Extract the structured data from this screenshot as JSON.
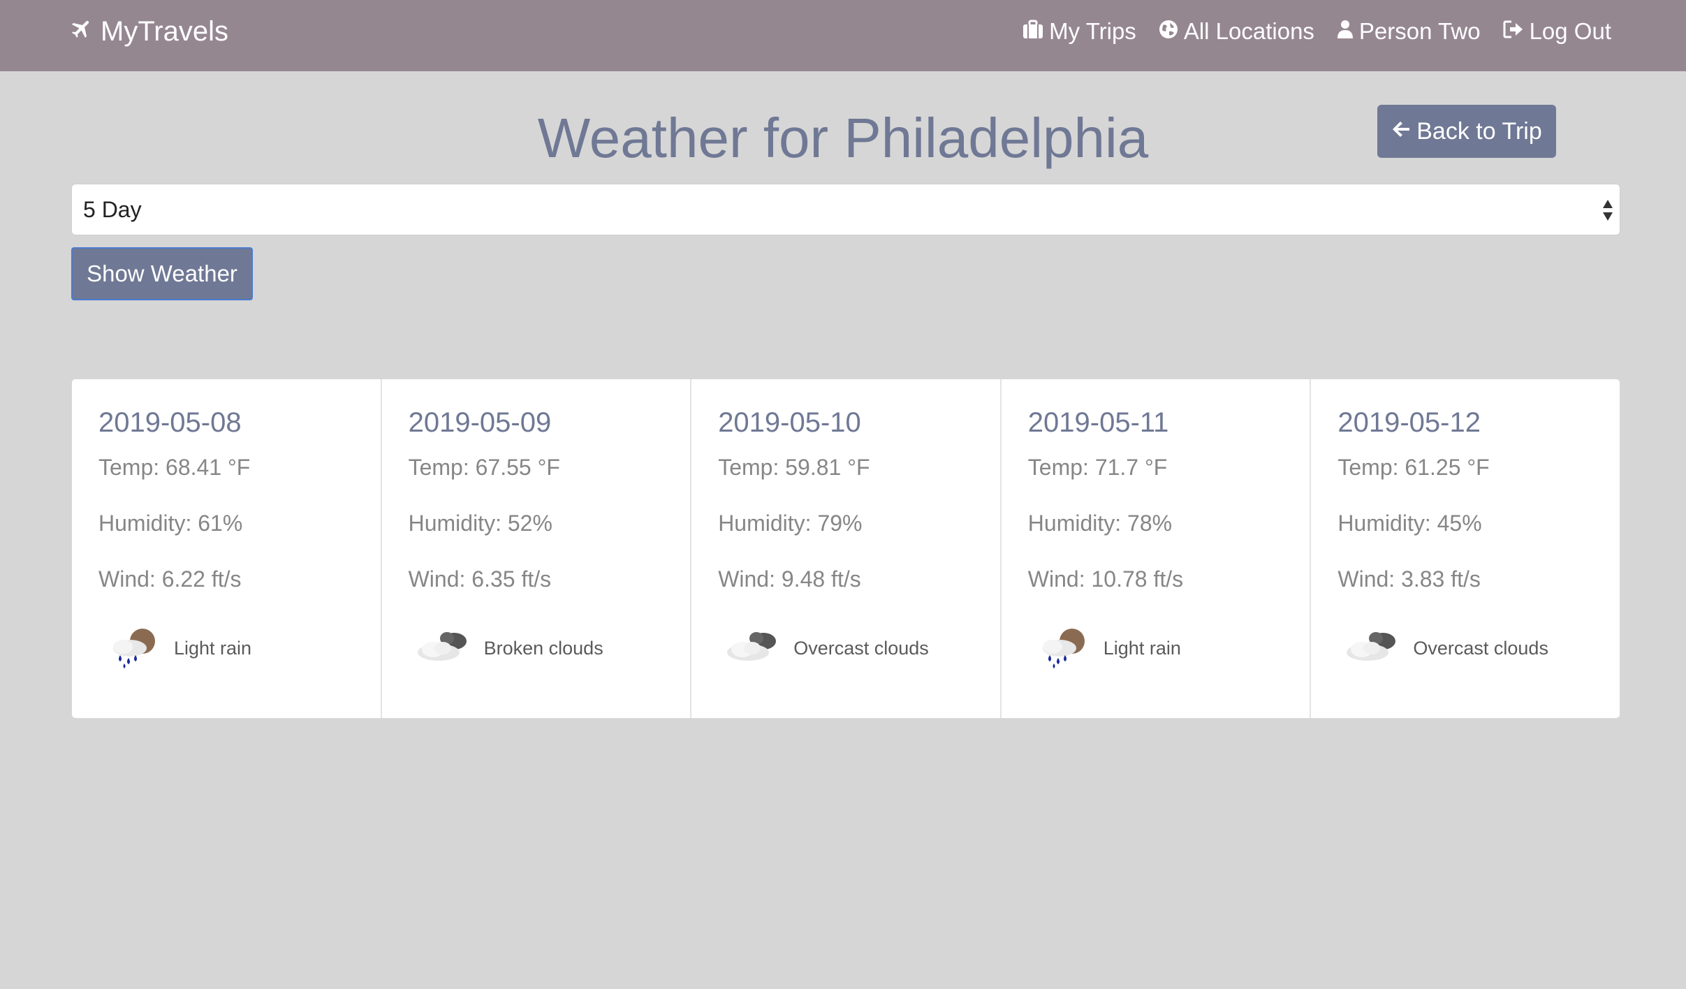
{
  "nav": {
    "brand": "MyTravels",
    "links": [
      {
        "label": "My Trips",
        "icon": "briefcase-icon"
      },
      {
        "label": "All Locations",
        "icon": "globe-icon"
      },
      {
        "label": "Person Two",
        "icon": "user-icon"
      },
      {
        "label": "Log Out",
        "icon": "log-out-icon"
      }
    ]
  },
  "header": {
    "title": "Weather for Philadelphia",
    "back_button": "Back to Trip"
  },
  "forecast_select": {
    "value": "5 Day"
  },
  "show_button": "Show Weather",
  "forecast": [
    {
      "date": "2019-05-08",
      "temp": "Temp: 68.41 °F",
      "humidity": "Humidity: 61%",
      "wind": "Wind: 6.22 ft/s",
      "condition": "Light rain",
      "icon": "light-rain-icon"
    },
    {
      "date": "2019-05-09",
      "temp": "Temp: 67.55 °F",
      "humidity": "Humidity: 52%",
      "wind": "Wind: 6.35 ft/s",
      "condition": "Broken clouds",
      "icon": "broken-clouds-icon"
    },
    {
      "date": "2019-05-10",
      "temp": "Temp: 59.81 °F",
      "humidity": "Humidity: 79%",
      "wind": "Wind: 9.48 ft/s",
      "condition": "Overcast clouds",
      "icon": "overcast-clouds-icon"
    },
    {
      "date": "2019-05-11",
      "temp": "Temp: 71.7 °F",
      "humidity": "Humidity: 78%",
      "wind": "Wind: 10.78 ft/s",
      "condition": "Light rain",
      "icon": "light-rain-icon"
    },
    {
      "date": "2019-05-12",
      "temp": "Temp: 61.25 °F",
      "humidity": "Humidity: 45%",
      "wind": "Wind: 3.83 ft/s",
      "condition": "Overcast clouds",
      "icon": "overcast-clouds-icon"
    }
  ],
  "colors": {
    "navbar": "#958790",
    "accent": "#6f7894",
    "background": "#d6d6d6"
  }
}
